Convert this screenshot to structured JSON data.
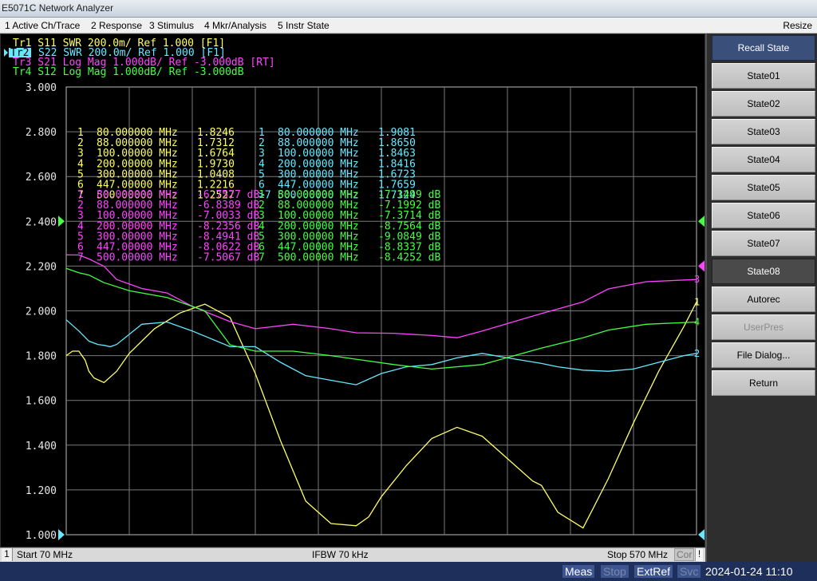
{
  "window": {
    "title": "E5071C Network Analyzer"
  },
  "menu": {
    "items": [
      "1 Active Ch/Trace",
      "2 Response",
      "3 Stimulus",
      "4 Mkr/Analysis",
      "5 Instr State"
    ],
    "resize": "Resize"
  },
  "softkeys": {
    "header": "Recall State",
    "buttons": [
      "State01",
      "State02",
      "State03",
      "State04",
      "State05",
      "State06",
      "State07",
      "State08",
      "Autorec",
      "UserPres",
      "File Dialog...",
      "Return"
    ],
    "active": "State08",
    "disabled": "UserPres"
  },
  "traces": [
    {
      "id": "Tr1",
      "label": "Tr1 S11 SWR 200.0m/ Ref 1.000 [F1]",
      "color": "#ffff66"
    },
    {
      "id": "Tr2",
      "label": "S22 SWR 200.0m/ Ref 1.000 [F1]",
      "color": "#66e8ff",
      "active": true
    },
    {
      "id": "Tr3",
      "label": "Tr3 S21 Log Mag 1.000dB/ Ref -3.000dB [RT]",
      "color": "#ff44ff"
    },
    {
      "id": "Tr4",
      "label": "Tr4 S12 Log Mag 1.000dB/ Ref -3.000dB",
      "color": "#44ff44"
    }
  ],
  "active_trace_tag": "Tr2",
  "markers": {
    "tr1": [
      [
        "1",
        "80.000000 MHz",
        "1.8246"
      ],
      [
        "2",
        "88.000000 MHz",
        "1.7312"
      ],
      [
        "3",
        "100.00000 MHz",
        "1.6764"
      ],
      [
        "4",
        "200.00000 MHz",
        "1.9730"
      ],
      [
        "5",
        "300.00000 MHz",
        "1.0408"
      ],
      [
        "6",
        "447.00000 MHz",
        "1.2216"
      ],
      [
        "7",
        "500.00000 MHz",
        "1.2527"
      ]
    ],
    "tr2": [
      [
        "1",
        "80.000000 MHz",
        "1.9081"
      ],
      [
        "2",
        "88.000000 MHz",
        "1.8650"
      ],
      [
        "3",
        "100.00000 MHz",
        "1.8463"
      ],
      [
        "4",
        "200.00000 MHz",
        "1.8416"
      ],
      [
        "5",
        "300.00000 MHz",
        "1.6723"
      ],
      [
        "6",
        "447.00000 MHz",
        "1.7659"
      ],
      [
        ">7",
        "500.00000 MHz",
        "1.7324"
      ]
    ],
    "tr3": [
      [
        "1",
        "80.000000 MHz",
        "-6.7527 dB"
      ],
      [
        "2",
        "88.000000 MHz",
        "-6.8389 dB"
      ],
      [
        "3",
        "100.00000 MHz",
        "-7.0033 dB"
      ],
      [
        "4",
        "200.00000 MHz",
        "-8.2356 dB"
      ],
      [
        "5",
        "300.00000 MHz",
        "-8.4941 dB"
      ],
      [
        "6",
        "447.00000 MHz",
        "-8.0622 dB"
      ],
      [
        "7",
        "500.00000 MHz",
        "-7.5067 dB"
      ]
    ],
    "tr4": [
      [
        "1",
        "80.000000 MHz",
        "-7.1499 dB"
      ],
      [
        "2",
        "88.000000 MHz",
        "-7.1992 dB"
      ],
      [
        "3",
        "100.00000 MHz",
        "-7.3714 dB"
      ],
      [
        "4",
        "200.00000 MHz",
        "-8.7564 dB"
      ],
      [
        "5",
        "300.00000 MHz",
        "-9.0849 dB"
      ],
      [
        "6",
        "447.00000 MHz",
        "-8.8337 dB"
      ],
      [
        "7",
        "500.00000 MHz",
        "-8.4252 dB"
      ]
    ]
  },
  "chart_data": {
    "type": "line",
    "xlim": [
      70,
      570
    ],
    "ylim": [
      1.0,
      3.0
    ],
    "yticks": [
      "3.000",
      "2.800",
      "2.600",
      "2.400",
      "2.200",
      "2.000",
      "1.800",
      "1.600",
      "1.400",
      "1.200",
      "1.000"
    ],
    "grid": true,
    "series": [
      {
        "name": "Tr1",
        "color": "#ffff66",
        "x": [
          70,
          75,
          80,
          85,
          88,
          92,
          96,
          100,
          110,
          120,
          140,
          160,
          180,
          200,
          220,
          240,
          260,
          280,
          300,
          310,
          320,
          340,
          360,
          380,
          400,
          420,
          440,
          447,
          460,
          480,
          500,
          520,
          540,
          560,
          570
        ],
        "y": [
          1.8,
          1.82,
          1.82,
          1.78,
          1.73,
          1.7,
          1.69,
          1.68,
          1.73,
          1.81,
          1.92,
          1.99,
          2.03,
          1.97,
          1.72,
          1.42,
          1.15,
          1.05,
          1.04,
          1.08,
          1.17,
          1.31,
          1.43,
          1.48,
          1.44,
          1.34,
          1.24,
          1.22,
          1.1,
          1.03,
          1.25,
          1.5,
          1.73,
          1.93,
          2.04
        ]
      },
      {
        "name": "Tr2",
        "color": "#66e8ff",
        "x": [
          70,
          80,
          88,
          95,
          100,
          105,
          110,
          130,
          150,
          170,
          200,
          220,
          240,
          260,
          280,
          300,
          320,
          340,
          360,
          380,
          400,
          420,
          447,
          460,
          480,
          500,
          520,
          540,
          560,
          570
        ],
        "y": [
          1.96,
          1.91,
          1.865,
          1.85,
          1.846,
          1.84,
          1.85,
          1.94,
          1.95,
          1.91,
          1.84,
          1.84,
          1.77,
          1.71,
          1.69,
          1.67,
          1.72,
          1.75,
          1.76,
          1.79,
          1.81,
          1.79,
          1.765,
          1.75,
          1.735,
          1.73,
          1.74,
          1.77,
          1.8,
          1.81
        ]
      },
      {
        "name": "Tr3",
        "color": "#ff44ff",
        "x": [
          70,
          80,
          88,
          100,
          110,
          130,
          150,
          170,
          200,
          220,
          250,
          280,
          300,
          330,
          360,
          380,
          400,
          447,
          480,
          500,
          530,
          570
        ],
        "y": [
          -6.75,
          -6.753,
          -6.84,
          -7.003,
          -7.3,
          -7.5,
          -7.6,
          -7.9,
          -8.24,
          -8.4,
          -8.3,
          -8.4,
          -8.49,
          -8.5,
          -8.55,
          -8.6,
          -8.45,
          -8.06,
          -7.8,
          -7.51,
          -7.35,
          -7.3
        ],
        "units": "dB"
      },
      {
        "name": "Tr4",
        "color": "#44ff44",
        "x": [
          70,
          80,
          88,
          100,
          120,
          150,
          180,
          200,
          220,
          250,
          280,
          300,
          330,
          360,
          400,
          447,
          480,
          500,
          530,
          570
        ],
        "y": [
          -7.05,
          -7.15,
          -7.2,
          -7.37,
          -7.55,
          -7.7,
          -8.0,
          -8.76,
          -8.9,
          -8.9,
          -9.0,
          -9.08,
          -9.2,
          -9.3,
          -9.2,
          -8.83,
          -8.6,
          -8.43,
          -8.3,
          -8.25
        ],
        "units": "dB"
      }
    ]
  },
  "channel": {
    "number": "1",
    "start": "Start 70 MHz",
    "ifbw": "IFBW 70 kHz",
    "stop": "Stop 570 MHz",
    "cor": "Cor",
    "excl": "!"
  },
  "statusbar": {
    "meas": "Meas",
    "stop": "Stop",
    "extref": "ExtRef",
    "svc": "Svc",
    "datetime": "2024-01-24 11:10"
  }
}
